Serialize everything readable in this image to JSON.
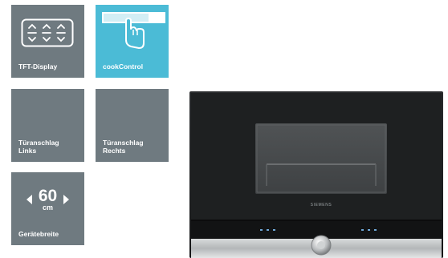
{
  "colors": {
    "tile_gray": "#6f7a80",
    "tile_active": "#4bbbd6"
  },
  "tiles": [
    {
      "label": "TFT-Display",
      "icon": "tft-display-icon",
      "active": false
    },
    {
      "label": "cookControl",
      "icon": "touch-control-icon",
      "active": true
    },
    {
      "label": "Türanschlag\nLinks",
      "icon": "",
      "active": false
    },
    {
      "label": "Türanschlag\nRechts",
      "icon": "",
      "active": false
    },
    {
      "label": "Gerätebreite",
      "icon": "width-arrows-icon",
      "width_value": "60",
      "width_unit": "cm",
      "active": false
    }
  ],
  "product": {
    "brand": "SIEMENS",
    "image": "built-in-oven-photo"
  }
}
